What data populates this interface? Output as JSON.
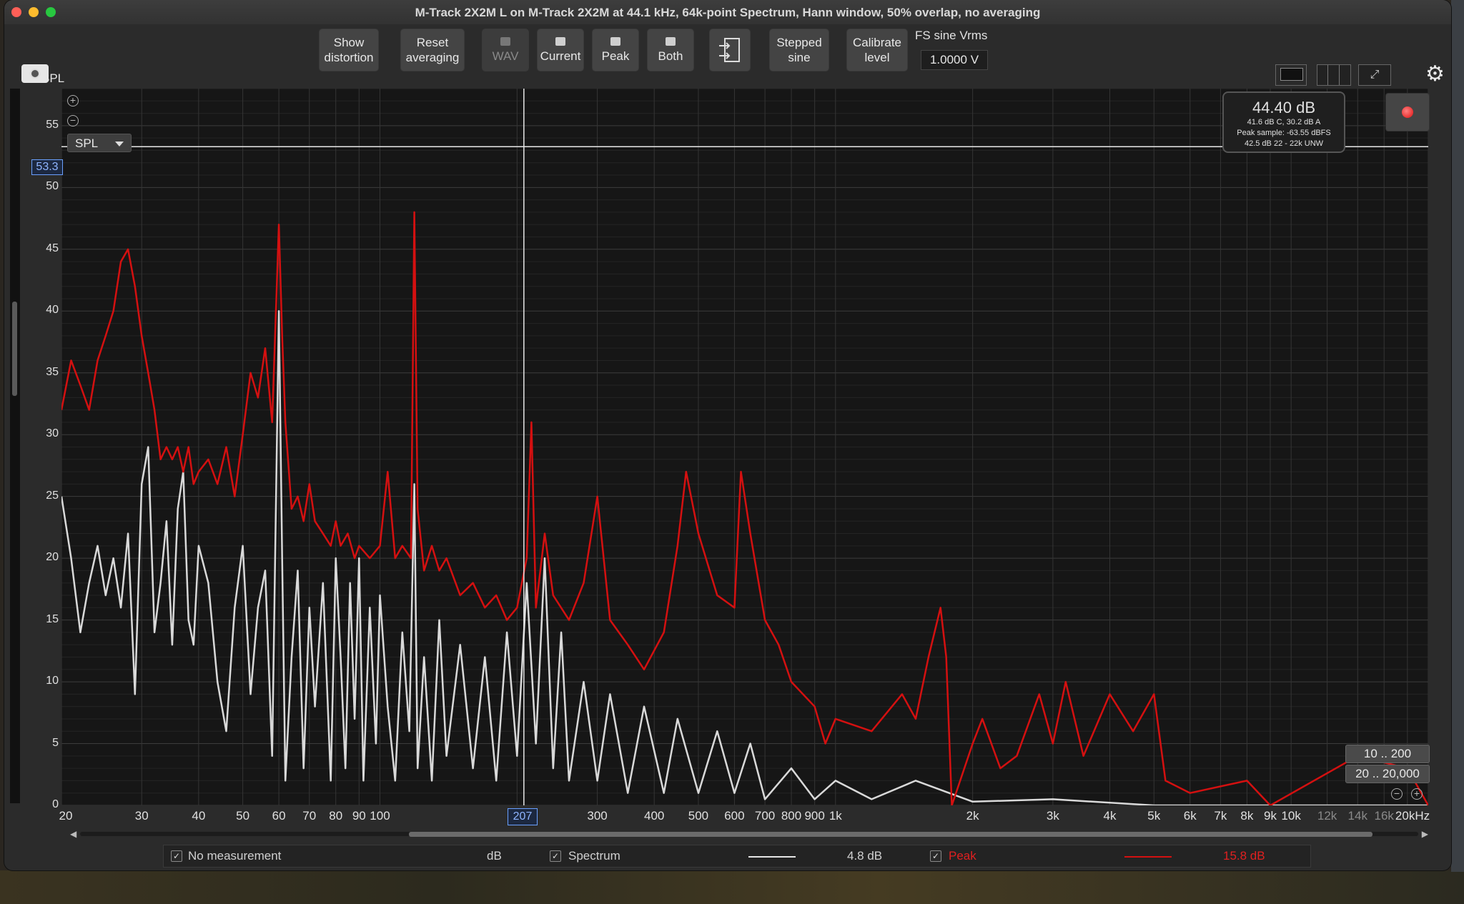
{
  "window": {
    "title": "M-Track 2X2M  L on M-Track 2X2M at 44.1 kHz, 64k-point Spectrum, Hann window, 50% overlap, no averaging"
  },
  "toolbar": {
    "show_distortion": [
      "Show",
      "distortion"
    ],
    "reset_averaging": [
      "Reset",
      "averaging"
    ],
    "wav": "WAV",
    "current": "Current",
    "peak": "Peak",
    "both": "Both",
    "stepped_sine": [
      "Stepped",
      "sine"
    ],
    "calibrate_level": [
      "Calibrate",
      "level"
    ],
    "fs_sine_label": "FS sine Vrms",
    "fs_sine_value": "1.0000 V"
  },
  "graph": {
    "y_axis_label": "SPL",
    "selector": "SPL",
    "cursor_y_value": "53.3",
    "cursor_x_value": "207",
    "y_ticks": [
      "55",
      "50",
      "45",
      "40",
      "35",
      "30",
      "25",
      "20",
      "15",
      "10",
      "5",
      "0"
    ],
    "x_ticks": [
      "20",
      "30",
      "40",
      "50",
      "60",
      "70",
      "80",
      "90",
      "100",
      "300",
      "400",
      "500",
      "600",
      "700",
      "800",
      "900",
      "1k",
      "2k",
      "3k",
      "4k",
      "5k",
      "6k",
      "7k",
      "8k",
      "9k",
      "10k",
      "12k",
      "14k",
      "16k",
      "20kHz"
    ],
    "spl_meter": {
      "main": "44.40 dB",
      "line1": "41.6 dB C, 30.2 dB A",
      "line2": "Peak sample: -63.55 dBFS",
      "line3": "42.5 dB 22 - 22k UNW"
    },
    "range_buttons": [
      "10 .. 200",
      "20 .. 20,000"
    ]
  },
  "legend": {
    "no_measurement": "No measurement",
    "unit": "dB",
    "spectrum_label": "Spectrum",
    "spectrum_value": "4.8 dB",
    "peak_label": "Peak",
    "peak_value": "15.8 dB"
  },
  "colors": {
    "spectrum": "#d9d9d9",
    "peak": "#d41010",
    "grid": "#3a3a3a"
  },
  "chart_data": {
    "type": "line",
    "x_scale": "log",
    "xlim": [
      20,
      20000
    ],
    "ylim": [
      0,
      58
    ],
    "ylabel": "SPL",
    "series": [
      {
        "name": "Spectrum",
        "color": "#d9d9d9",
        "points": [
          [
            20,
            25
          ],
          [
            21,
            20
          ],
          [
            22,
            14
          ],
          [
            23,
            18
          ],
          [
            24,
            21
          ],
          [
            25,
            17
          ],
          [
            26,
            20
          ],
          [
            27,
            16
          ],
          [
            28,
            22
          ],
          [
            29,
            9
          ],
          [
            30,
            26
          ],
          [
            31,
            29
          ],
          [
            32,
            14
          ],
          [
            33,
            18
          ],
          [
            34,
            23
          ],
          [
            35,
            13
          ],
          [
            36,
            24
          ],
          [
            37,
            27
          ],
          [
            38,
            15
          ],
          [
            39,
            13
          ],
          [
            40,
            21
          ],
          [
            42,
            18
          ],
          [
            44,
            10
          ],
          [
            46,
            6
          ],
          [
            48,
            16
          ],
          [
            50,
            21
          ],
          [
            52,
            9
          ],
          [
            54,
            16
          ],
          [
            56,
            19
          ],
          [
            58,
            4
          ],
          [
            60,
            40
          ],
          [
            61,
            20
          ],
          [
            62,
            2
          ],
          [
            64,
            12
          ],
          [
            66,
            19
          ],
          [
            68,
            3
          ],
          [
            70,
            16
          ],
          [
            72,
            8
          ],
          [
            75,
            18
          ],
          [
            78,
            2
          ],
          [
            80,
            20
          ],
          [
            82,
            12
          ],
          [
            84,
            3
          ],
          [
            86,
            18
          ],
          [
            88,
            7
          ],
          [
            90,
            20
          ],
          [
            92,
            2
          ],
          [
            95,
            16
          ],
          [
            98,
            5
          ],
          [
            100,
            17
          ],
          [
            104,
            8
          ],
          [
            108,
            2
          ],
          [
            112,
            14
          ],
          [
            116,
            6
          ],
          [
            119,
            26
          ],
          [
            121,
            3
          ],
          [
            125,
            12
          ],
          [
            130,
            2
          ],
          [
            135,
            15
          ],
          [
            140,
            4
          ],
          [
            150,
            13
          ],
          [
            160,
            3
          ],
          [
            170,
            12
          ],
          [
            180,
            2
          ],
          [
            190,
            14
          ],
          [
            200,
            4
          ],
          [
            210,
            18
          ],
          [
            220,
            5
          ],
          [
            230,
            20
          ],
          [
            240,
            3
          ],
          [
            250,
            14
          ],
          [
            260,
            2
          ],
          [
            280,
            10
          ],
          [
            300,
            2
          ],
          [
            320,
            9
          ],
          [
            350,
            1
          ],
          [
            380,
            8
          ],
          [
            420,
            1
          ],
          [
            450,
            7
          ],
          [
            500,
            1
          ],
          [
            550,
            6
          ],
          [
            600,
            1
          ],
          [
            650,
            5
          ],
          [
            700,
            0.5
          ],
          [
            800,
            3
          ],
          [
            900,
            0.5
          ],
          [
            1000,
            2
          ],
          [
            1200,
            0.5
          ],
          [
            1500,
            2
          ],
          [
            2000,
            0.3
          ],
          [
            3000,
            0.5
          ],
          [
            5000,
            0
          ],
          [
            20000,
            0
          ]
        ]
      },
      {
        "name": "Peak",
        "color": "#d41010",
        "points": [
          [
            20,
            32
          ],
          [
            21,
            36
          ],
          [
            22,
            34
          ],
          [
            23,
            32
          ],
          [
            24,
            36
          ],
          [
            25,
            38
          ],
          [
            26,
            40
          ],
          [
            27,
            44
          ],
          [
            28,
            45
          ],
          [
            29,
            42
          ],
          [
            30,
            38
          ],
          [
            31,
            35
          ],
          [
            32,
            32
          ],
          [
            33,
            28
          ],
          [
            34,
            29
          ],
          [
            35,
            28
          ],
          [
            36,
            29
          ],
          [
            37,
            27
          ],
          [
            38,
            29
          ],
          [
            39,
            26
          ],
          [
            40,
            27
          ],
          [
            42,
            28
          ],
          [
            44,
            26
          ],
          [
            46,
            29
          ],
          [
            48,
            25
          ],
          [
            50,
            30
          ],
          [
            52,
            35
          ],
          [
            54,
            33
          ],
          [
            56,
            37
          ],
          [
            58,
            31
          ],
          [
            60,
            47
          ],
          [
            61,
            38
          ],
          [
            62,
            31
          ],
          [
            64,
            24
          ],
          [
            66,
            25
          ],
          [
            68,
            23
          ],
          [
            70,
            26
          ],
          [
            72,
            23
          ],
          [
            75,
            22
          ],
          [
            78,
            21
          ],
          [
            80,
            23
          ],
          [
            82,
            21
          ],
          [
            85,
            22
          ],
          [
            88,
            20
          ],
          [
            90,
            21
          ],
          [
            95,
            20
          ],
          [
            100,
            21
          ],
          [
            104,
            27
          ],
          [
            108,
            20
          ],
          [
            112,
            21
          ],
          [
            117,
            20
          ],
          [
            119,
            48
          ],
          [
            121,
            24
          ],
          [
            125,
            19
          ],
          [
            130,
            21
          ],
          [
            135,
            19
          ],
          [
            140,
            20
          ],
          [
            150,
            17
          ],
          [
            160,
            18
          ],
          [
            170,
            16
          ],
          [
            180,
            17
          ],
          [
            190,
            15
          ],
          [
            200,
            16
          ],
          [
            210,
            20
          ],
          [
            215,
            31
          ],
          [
            220,
            16
          ],
          [
            230,
            22
          ],
          [
            240,
            17
          ],
          [
            260,
            15
          ],
          [
            280,
            18
          ],
          [
            300,
            25
          ],
          [
            320,
            15
          ],
          [
            350,
            13
          ],
          [
            380,
            11
          ],
          [
            420,
            14
          ],
          [
            450,
            21
          ],
          [
            470,
            27
          ],
          [
            500,
            22
          ],
          [
            550,
            17
          ],
          [
            600,
            16
          ],
          [
            620,
            27
          ],
          [
            650,
            22
          ],
          [
            700,
            15
          ],
          [
            750,
            13
          ],
          [
            800,
            10
          ],
          [
            900,
            8
          ],
          [
            950,
            5
          ],
          [
            1000,
            7
          ],
          [
            1200,
            6
          ],
          [
            1400,
            9
          ],
          [
            1500,
            7
          ],
          [
            1600,
            12
          ],
          [
            1700,
            16
          ],
          [
            1750,
            12
          ],
          [
            1800,
            0
          ],
          [
            2000,
            5
          ],
          [
            2100,
            7
          ],
          [
            2300,
            3
          ],
          [
            2500,
            4
          ],
          [
            2800,
            9
          ],
          [
            3000,
            5
          ],
          [
            3200,
            10
          ],
          [
            3500,
            4
          ],
          [
            4000,
            9
          ],
          [
            4500,
            6
          ],
          [
            5000,
            9
          ],
          [
            5300,
            2
          ],
          [
            6000,
            1
          ],
          [
            8000,
            2
          ],
          [
            9000,
            0
          ],
          [
            14000,
            4
          ],
          [
            18000,
            3
          ],
          [
            20000,
            0
          ]
        ]
      }
    ]
  }
}
